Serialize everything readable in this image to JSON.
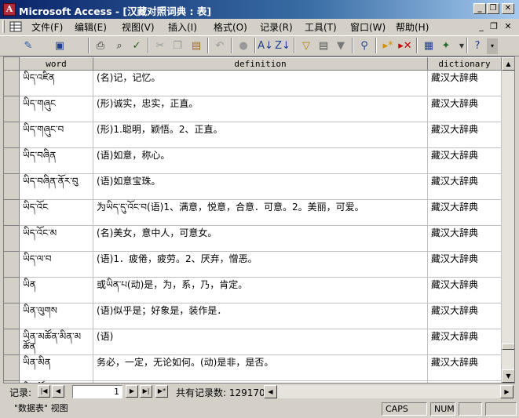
{
  "window": {
    "title": "Microsoft Access - [汉藏对照词典 : 表]",
    "app_icon_letter": "A",
    "minimize": "_",
    "restore": "❐",
    "close": "✕"
  },
  "menu": {
    "items": [
      "文件(F)",
      "编辑(E)",
      "视图(V)",
      "插入(I)",
      "格式(O)",
      "记录(R)",
      "工具(T)",
      "窗口(W)",
      "帮助(H)"
    ],
    "mdi_min": "_",
    "mdi_restore": "❐",
    "mdi_close": "✕"
  },
  "toolbar": {
    "icons": [
      "view-design",
      "save",
      "print",
      "print-preview",
      "spelling",
      "cut",
      "copy",
      "paste",
      "undo",
      "insert-hyperlink",
      "sort-ascending",
      "sort-descending",
      "filter-by-selection",
      "filter-by-form",
      "apply-filter",
      "find",
      "new-record",
      "delete-record",
      "database-window",
      "new-object",
      "help"
    ]
  },
  "table": {
    "columns": [
      "word",
      "definition",
      "dictionary"
    ],
    "rows": [
      {
        "word": "ཡིད་འཛིན",
        "definition": "(名)记，记忆。",
        "dictionary": "藏汉大辞典"
      },
      {
        "word": "ཡིད་གཞུང",
        "definition": "(形)诚实，忠实，正直。",
        "dictionary": "藏汉大辞典"
      },
      {
        "word": "ཡིད་གཞུང་བ",
        "definition": "(形)1.聪明，颖悟。2、正直。",
        "dictionary": "藏汉大辞典"
      },
      {
        "word": "ཡིད་བཞིན",
        "definition": "(语)如意，称心。",
        "dictionary": "藏汉大辞典"
      },
      {
        "word": "ཡིད་བཞིན་ནོར་བུ",
        "definition": "(语)如意宝珠。",
        "dictionary": "藏汉大辞典"
      },
      {
        "word": "ཡིད་འོང",
        "definition": "为ཡིད་དུ་འོང་བ(语)1、满意，悦意，合意．可意。2。美丽，可爱。",
        "dictionary": "藏汉大辞典"
      },
      {
        "word": "ཡིད་འོང་མ",
        "definition": "(名)美女，意中人，可意女。",
        "dictionary": "藏汉大辞典"
      },
      {
        "word": "ཡིད་ལ་བ",
        "definition": "(语)1．疲倦，疲劳。2、厌弃，憎恶。",
        "dictionary": "藏汉大辞典"
      },
      {
        "word": "ཡིན",
        "definition": "或ཡིན་པ(动)是，为，系，乃，肯定。",
        "dictionary": "藏汉大辞典"
      },
      {
        "word": "ཡིན་ལུགས",
        "definition": "(语)似乎是；好象是，装作是．",
        "dictionary": "藏汉大辞典"
      },
      {
        "word": "ཡིན་མཚོན་མིན་མཚོན",
        "definition": "(语)",
        "dictionary": "藏汉大辞典"
      },
      {
        "word": "ཡིན་མིན",
        "definition": "务必，一定，无论如何。(动)是非，是否。",
        "dictionary": "藏汉大辞典"
      },
      {
        "word": "ཡིན་ཚོད",
        "definition": "(语)……",
        "dictionary": "藏汉大辞典"
      }
    ]
  },
  "navigation": {
    "label": "记录:",
    "first": "|◀",
    "prev": "◀",
    "current_record": "1",
    "next": "▶",
    "last": "▶|",
    "new": "▶*",
    "total_text": "共有记录数: 129170"
  },
  "status": {
    "view": "\"数据表\" 视图",
    "caps": "CAPS",
    "num": "NUM"
  }
}
